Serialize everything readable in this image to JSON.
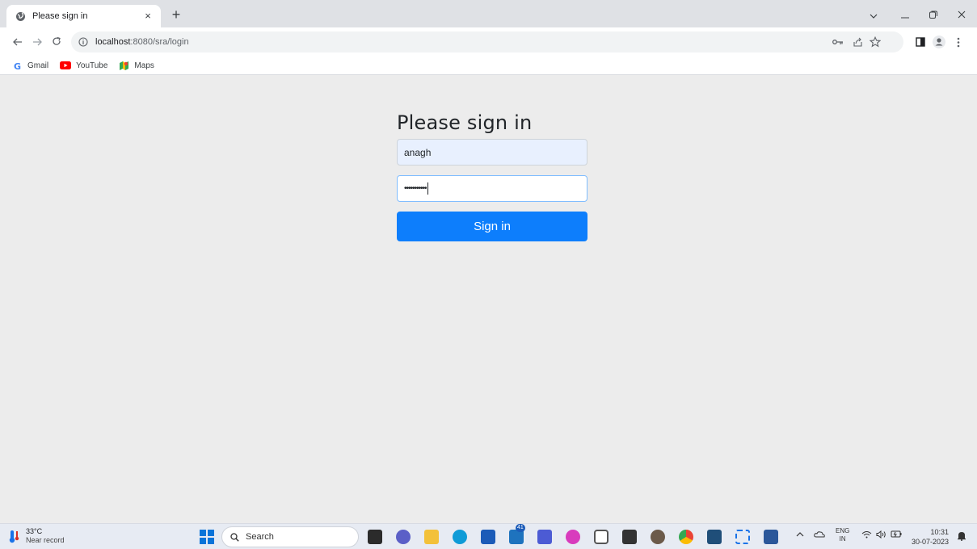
{
  "browser": {
    "tab_title": "Please sign in",
    "tab_close": "×",
    "new_tab": "+",
    "url_host": "localhost",
    "url_path": ":8080/sra/login"
  },
  "bookmarks": [
    {
      "label": "Gmail",
      "icon": "gmail-icon"
    },
    {
      "label": "YouTube",
      "icon": "youtube-icon"
    },
    {
      "label": "Maps",
      "icon": "maps-icon"
    }
  ],
  "login": {
    "heading": "Please sign in",
    "username_value": "anagh",
    "password_mask": "•••••••••••",
    "button_label": "Sign in",
    "button_color": "#0d7efc",
    "autofill_bg": "#e8f0fe"
  },
  "taskbar": {
    "weather_temp": "33°C",
    "weather_desc": "Near record",
    "search_label": "Search",
    "lang_line1": "ENG",
    "lang_line2": "IN",
    "time": "10:31",
    "date": "30-07-2023",
    "mail_badge": "41"
  }
}
